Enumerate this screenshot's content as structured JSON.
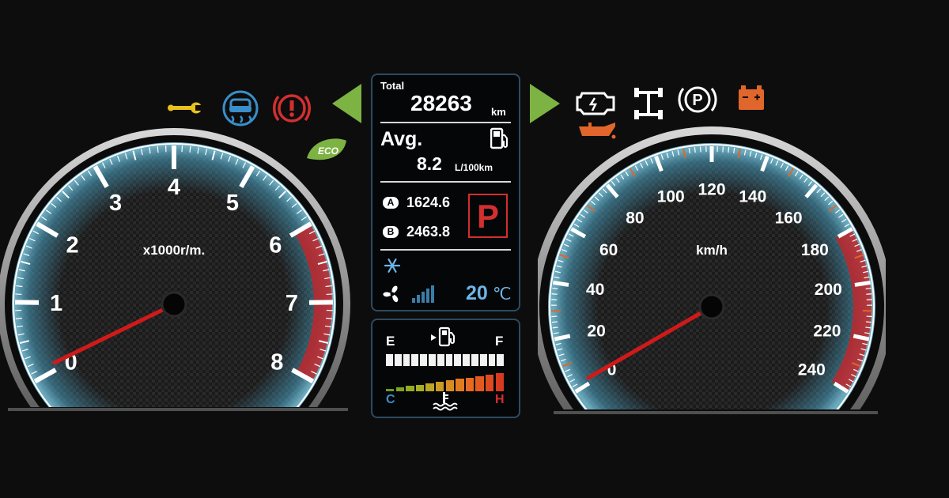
{
  "tachometer": {
    "ticks": [
      "0",
      "1",
      "2",
      "3",
      "4",
      "5",
      "6",
      "7",
      "8"
    ],
    "unit": "x1000r/m.",
    "needle_value": 0.1,
    "redline_start": 6
  },
  "speedometer": {
    "ticks": [
      "0",
      "20",
      "40",
      "60",
      "80",
      "100",
      "120",
      "140",
      "160",
      "180",
      "200",
      "220",
      "240"
    ],
    "unit": "km/h",
    "needle_value": 2,
    "redline_start": 180
  },
  "info": {
    "total_label": "Total",
    "total_value": "28263",
    "total_unit": "km",
    "avg_label": "Avg.",
    "avg_value": "8.2",
    "avg_unit": "L/100km",
    "trip_a_label": "A",
    "trip_a_value": "1624.6",
    "trip_b_label": "B",
    "trip_b_value": "2463.8",
    "gear": "P",
    "temp_value": "20",
    "temp_unit": "℃"
  },
  "fuel": {
    "empty_label": "E",
    "full_label": "F",
    "level": 1.0
  },
  "coolant": {
    "cold_label": "C",
    "hot_label": "H",
    "level": 1.0
  },
  "indicators": {
    "eco_label": "ECO"
  },
  "colors": {
    "background": "#0d0d0d",
    "panel_border": "#2d4a60",
    "glow_blue": "#4aa3c4",
    "redline": "#c0262a",
    "needle": "#d01a1a",
    "indicator_green": "#7cb342",
    "warning_orange": "#e0662b",
    "warning_red": "#d32f2f",
    "service_yellow": "#e8c21a",
    "temp_blue": "#6db5e6"
  },
  "icons": [
    "wrench-icon",
    "traction-control-icon",
    "brake-warning-icon",
    "eco-icon",
    "left-turn-signal-icon",
    "right-turn-signal-icon",
    "check-engine-icon",
    "oil-pressure-icon",
    "differential-lock-icon",
    "parking-brake-icon",
    "battery-icon",
    "fuel-pump-icon",
    "snowflake-icon",
    "fan-icon",
    "coolant-temperature-icon"
  ]
}
